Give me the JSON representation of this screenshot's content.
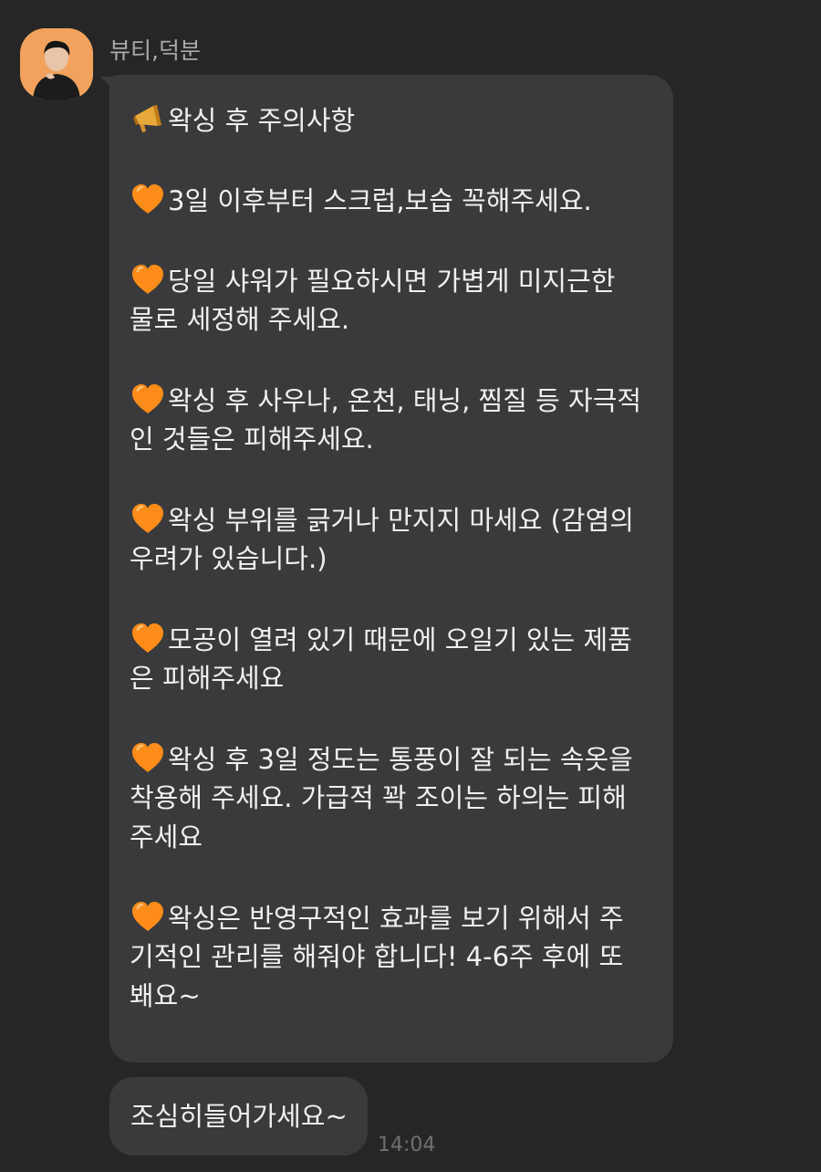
{
  "chat": {
    "sender_name": "뷰티,덕분",
    "message_heading": "왁싱 후 주의사항",
    "items": [
      {
        "lines": [
          "3일 이후부터 스크럽,보습 꼭해주세요."
        ]
      },
      {
        "lines": [
          "당일 샤워가 필요하시면 가볍게 미지근한",
          "물로 세정해 주세요."
        ]
      },
      {
        "lines": [
          "왁싱 후 사우나, 온천, 태닝, 찜질 등 자극적",
          "인 것들은 피해주세요."
        ]
      },
      {
        "lines": [
          "왁싱 부위를 긁거나 만지지 마세요 (감염의",
          "우려가 있습니다.)"
        ]
      },
      {
        "lines": [
          "모공이 열려 있기 때문에 오일기 있는 제품",
          "은 피해주세요"
        ]
      },
      {
        "lines": [
          "왁싱 후 3일 정도는 통풍이 잘 되는 속옷을",
          "착용해 주세요. 가급적 꽉 조이는 하의는 피해",
          "주세요"
        ]
      },
      {
        "lines": [
          "왁싱은 반영구적인 효과를 보기 위해서 주",
          "기적인 관리를 해줘야 합니다! 4-6주 후에 또",
          "봬요~"
        ]
      }
    ],
    "second_message": "조심히들어가세요~",
    "timestamp": "14:04"
  },
  "icons": {
    "heading_icon": "megaphone-icon",
    "bullet_icon": "orange-heart-icon"
  },
  "colors": {
    "background": "#262626",
    "bubble": "#3a3a3c",
    "heart": "#ff8c1a",
    "avatar_bg": "#f2a25c"
  }
}
